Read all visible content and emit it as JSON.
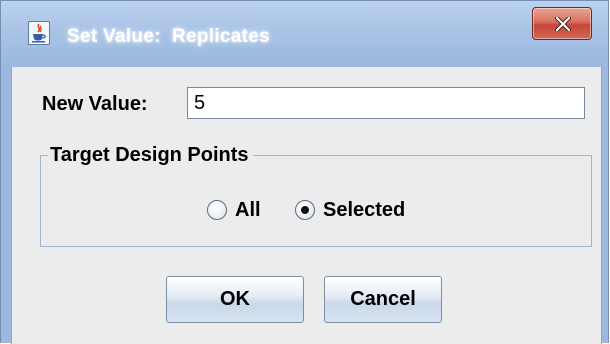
{
  "window": {
    "title": "Set Value:  Replicates",
    "app_icon": "java-cup-icon",
    "close_icon": "close-icon"
  },
  "form": {
    "new_value_label": "New Value:",
    "new_value": "5"
  },
  "target_group": {
    "title": "Target Design Points",
    "options": [
      {
        "label": "All",
        "selected": false
      },
      {
        "label": "Selected",
        "selected": true
      }
    ]
  },
  "buttons": {
    "ok_label": "OK",
    "cancel_label": "Cancel"
  },
  "colors": {
    "title_bar": "#a9c3e6",
    "close_button": "#c4463a",
    "dialog_background": "#ececec"
  }
}
